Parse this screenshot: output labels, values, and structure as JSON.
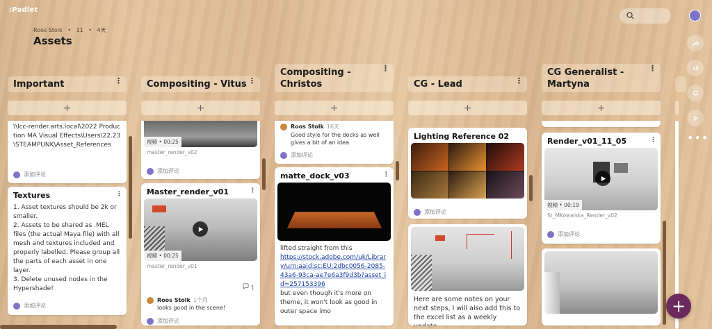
{
  "app": {
    "logo": ":Padlet"
  },
  "board": {
    "author": "Roos Stolk",
    "dot1": "•",
    "count": "11",
    "dot2": "•",
    "age": "4天",
    "title": "Assets"
  },
  "ui": {
    "add_label": "+",
    "comment_label": "添加评论",
    "video_label": "视频",
    "dot_sep": "•",
    "fab_label": "+",
    "menu_dots": "⋮",
    "rail_more": "•••"
  },
  "columns": [
    {
      "title": "Important",
      "cards": [
        {
          "path_text": "\\\\lcc-render.arts.local\\2022 Production MA Visual Effects\\Users\\22.23\\STEAMPUNK\\Asset_References"
        },
        {
          "title": "Textures",
          "lines": [
            "1. Asset textures should be 2k or smaller.",
            "2. Assets to be shared as .MEL files (the actual Maya file) with all mesh and textures included and properly labelled. Please group all the parts of each asset in one layer.",
            "3. Delete unused nodes in the Hypershade!"
          ]
        }
      ]
    },
    {
      "title": "Compositing - Vitus",
      "cards": [
        {
          "duration": "00:25",
          "caption": "master_render_v02"
        },
        {
          "title": "Master_render_v01",
          "duration": "00:25",
          "caption": "master_render_v01",
          "comment_count": "1",
          "comment_author": "Roos Stolk",
          "comment_time": "1个月",
          "comment_text": "looks good in the scene!"
        }
      ]
    },
    {
      "title": "Compositing - Christos",
      "cards": [
        {
          "comment_author": "Roos Stolk",
          "comment_time": "16天",
          "comment_text": "Good style for the docks as well gives a bit of an idea"
        },
        {
          "title": "matte_dock_v03",
          "intro": "lifted straight from this",
          "link": "https://stock.adobe.com/uk/Library/urn:aaid:sc:EU:2dbc0056-2085-43a6-93ca-ae7e6a3f9d3b?asset_id=257153396",
          "outro": "but even though it's more on theme, it won't look as good in outer space imo"
        }
      ]
    },
    {
      "title": "CG - Lead",
      "cards": [
        {
          "title": "Lighting Reference 02"
        },
        {
          "body": "Here are some notes on your next steps, I will also add this to the excel list as a weekly update"
        }
      ]
    },
    {
      "title": "CG Generalist - Martyna",
      "cards": [
        {
          "title": "Render_v01_11_05",
          "duration": "00:19",
          "caption": "St_MKowalska_Render_v02"
        },
        {}
      ]
    }
  ]
}
